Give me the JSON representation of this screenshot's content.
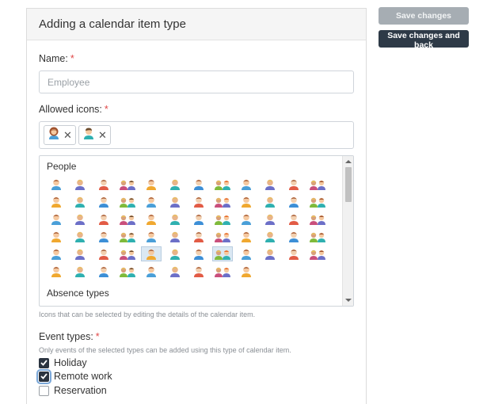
{
  "form": {
    "title": "Adding a calendar item type",
    "name_label": "Name:",
    "name_placeholder": "Employee",
    "name_value": "",
    "required_mark": "*",
    "allowed_icons_label": "Allowed icons:",
    "selected_icons": [
      {
        "icon": "woman-employee-icon",
        "remove": "✕"
      },
      {
        "icon": "man-employee-icon",
        "remove": "✕"
      }
    ],
    "icon_groups": [
      {
        "title": "People",
        "icon_count": 69
      },
      {
        "title": "Absence types",
        "icon_count": 8
      }
    ],
    "icons_hint": "Icons that can be selected by editing the details of the calendar item.",
    "event_types_label": "Event types:",
    "event_types_hint": "Only events of the selected types can be added using this type of calendar item.",
    "event_types": [
      {
        "label": "Holiday",
        "checked": true
      },
      {
        "label": "Remote work",
        "checked": true
      },
      {
        "label": "Reservation",
        "checked": false
      }
    ]
  },
  "actions": {
    "save_label": "Save changes",
    "save_back_label": "Save changes and back"
  },
  "colors": {
    "accent_dark": "#2e3a47",
    "disabled_button": "#a6adb3",
    "required": "#e04848",
    "selected_icon_bg": "#dbe8f3"
  }
}
